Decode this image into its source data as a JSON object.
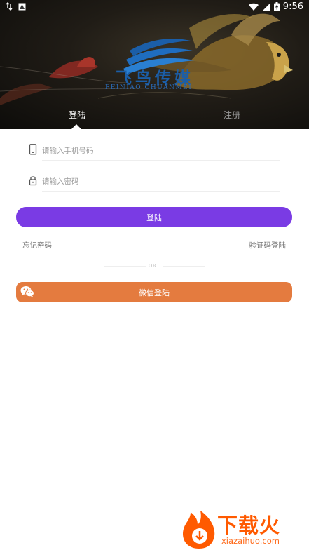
{
  "status_bar": {
    "time": "9:56",
    "icons": [
      "data-transfer-icon",
      "notification-icon",
      "wifi-icon",
      "signal-icon",
      "battery-icon"
    ]
  },
  "banner": {
    "logo_text": "飞鸟传媒",
    "logo_subtext": "FEINIAO CHUANMEI",
    "accent_color": "#1b5ea8"
  },
  "tabs": [
    {
      "label": "登陆",
      "active": true
    },
    {
      "label": "注册",
      "active": false
    }
  ],
  "form": {
    "phone": {
      "placeholder": "请输入手机号码",
      "value": "",
      "icon": "phone-icon"
    },
    "password": {
      "placeholder": "请输入密码",
      "value": "",
      "icon": "lock-icon"
    }
  },
  "buttons": {
    "login_label": "登陆",
    "login_color": "#7a3be4",
    "wechat_label": "微信登陆",
    "wechat_color": "#e47b3f"
  },
  "links": {
    "forgot_password": "忘记密码",
    "sms_login": "验证码登陆"
  },
  "divider_text": "OR",
  "watermark": {
    "text": "下载火",
    "subtext": "xiazaihuo.com",
    "color": "#ff5a00"
  }
}
